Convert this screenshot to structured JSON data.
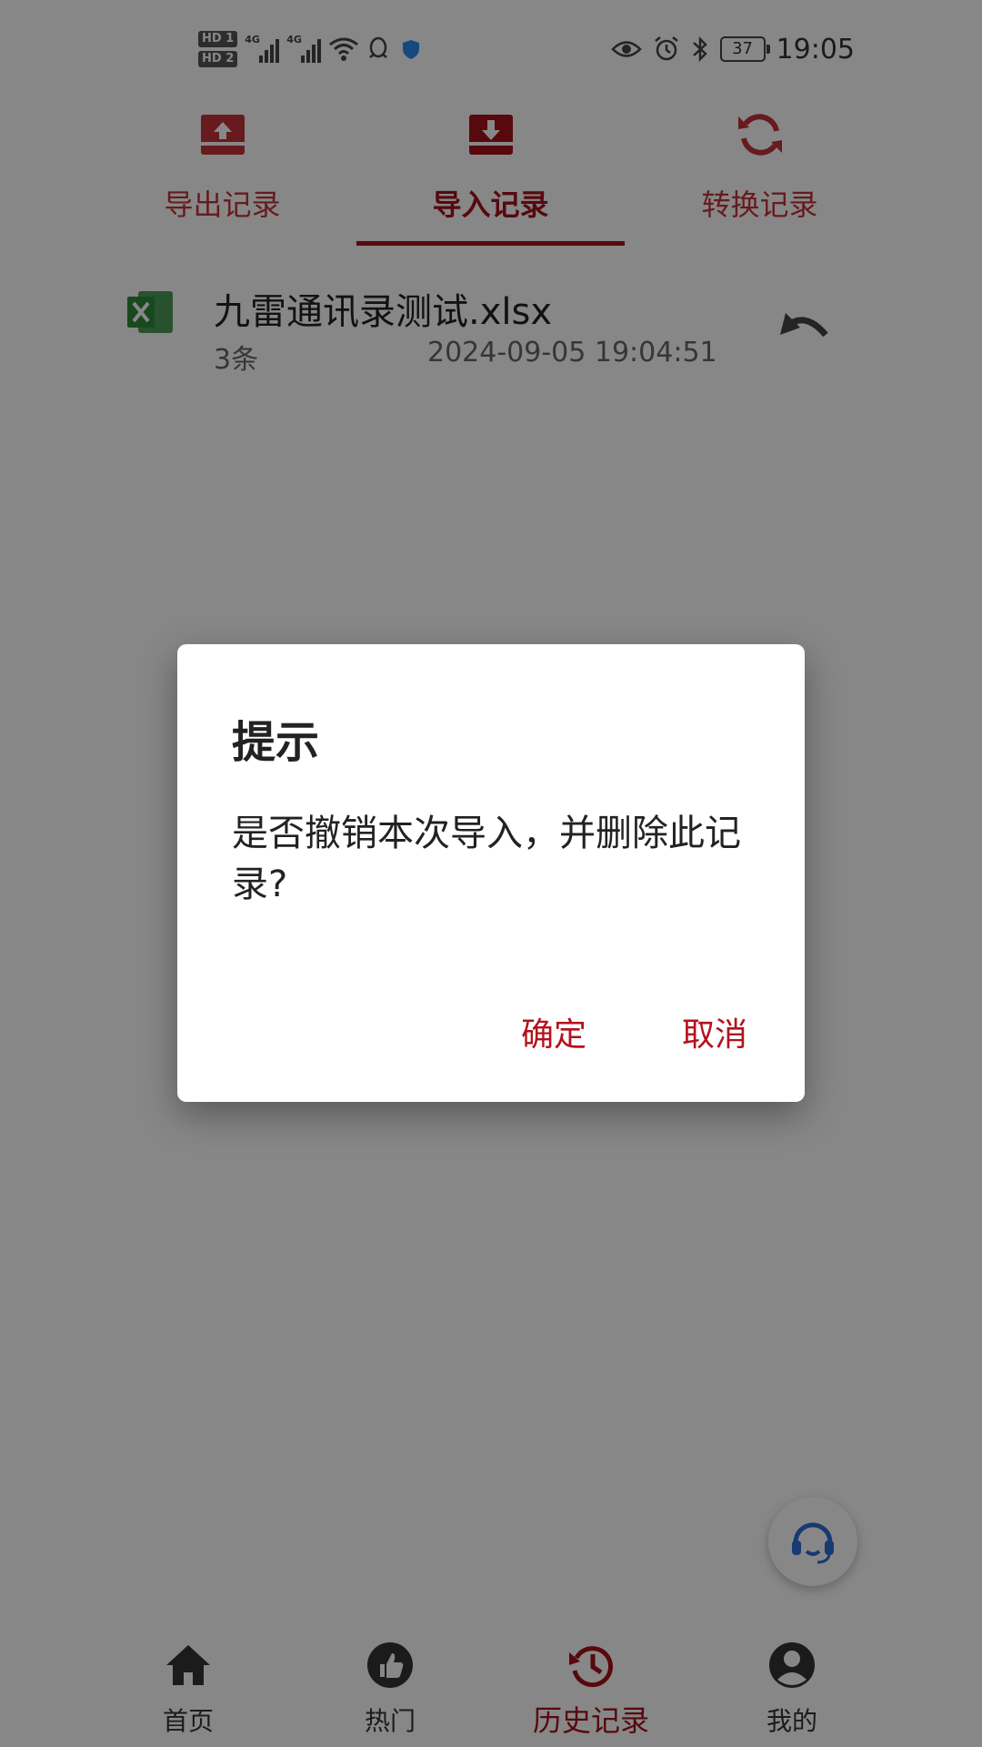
{
  "status_bar": {
    "sim1": "HD 1",
    "sim2": "HD 2",
    "network1": "4G",
    "network2": "4G",
    "battery": "37",
    "time": "19:05",
    "icons": [
      "signal-icon",
      "wifi-icon",
      "qq-icon",
      "shield-app-icon",
      "eye-icon",
      "alarm-icon",
      "bluetooth-icon",
      "battery-icon"
    ]
  },
  "tabs": [
    {
      "label": "导出记录",
      "icon": "export-tray-icon",
      "active": false
    },
    {
      "label": "导入记录",
      "icon": "import-tray-icon",
      "active": true
    },
    {
      "label": "转换记录",
      "icon": "refresh-icon",
      "active": false
    }
  ],
  "records": [
    {
      "file_name": "九雷通讯录测试.xlsx",
      "count": "3条",
      "time": "2024-09-05 19:04:51",
      "file_icon": "excel-file-icon",
      "action_icon": "undo-icon"
    }
  ],
  "dialog": {
    "title": "提示",
    "message": "是否撤销本次导入，并删除此记录?",
    "confirm_label": "确定",
    "cancel_label": "取消"
  },
  "bottom_nav": [
    {
      "label": "首页",
      "icon": "home-icon",
      "active": false
    },
    {
      "label": "热门",
      "icon": "thumbs-up-icon",
      "active": false
    },
    {
      "label": "历史记录",
      "icon": "history-icon",
      "active": true
    },
    {
      "label": "我的",
      "icon": "profile-icon",
      "active": false
    }
  ],
  "colors": {
    "accent": "#a5121c",
    "accent_light": "#c2343a",
    "excel_green": "#2e8b3a",
    "service_blue": "#2a6fd6",
    "overlay": "rgba(0,0,0,0.47)"
  }
}
